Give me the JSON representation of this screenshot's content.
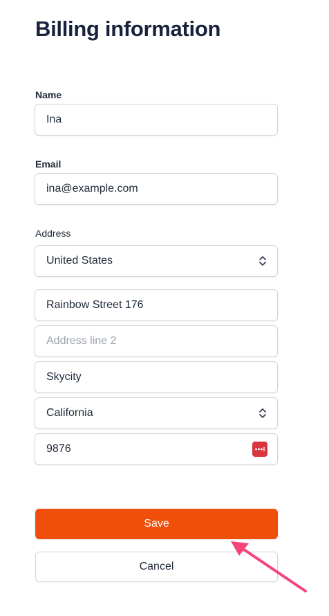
{
  "page": {
    "title": "Billing information"
  },
  "form": {
    "name": {
      "label": "Name",
      "value": "Ina"
    },
    "email": {
      "label": "Email",
      "value": "ina@example.com"
    },
    "address": {
      "label": "Address",
      "country": {
        "value": "United States",
        "icon": "chevron-up-down-icon"
      },
      "line1": {
        "value": "Rainbow Street 176"
      },
      "line2": {
        "value": "",
        "placeholder": "Address line 2"
      },
      "city": {
        "value": "Skycity"
      },
      "state": {
        "value": "California",
        "icon": "chevron-up-down-icon"
      },
      "zip": {
        "value": "9876",
        "icon": "password-manager-icon"
      }
    }
  },
  "actions": {
    "save_label": "Save",
    "cancel_label": "Cancel"
  },
  "annotation": {
    "icon": "pink-arrow-icon"
  },
  "colors": {
    "accent": "#f04e0b",
    "title": "#18223a",
    "border": "#d1d5db",
    "placeholder": "#9ca3af",
    "arrow": "#f5457a",
    "password_manager_icon": "#d9363e"
  }
}
